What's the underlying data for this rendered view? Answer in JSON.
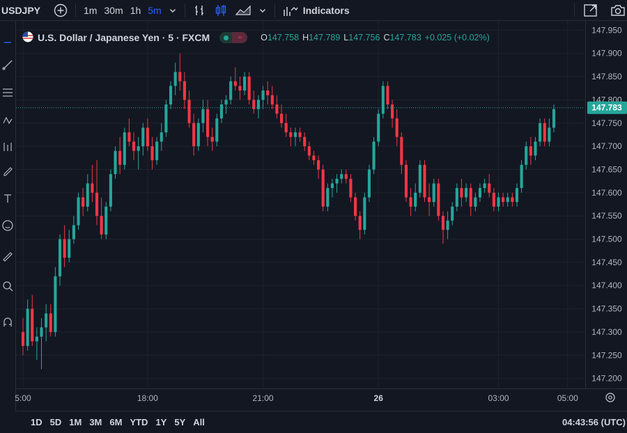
{
  "topbar": {
    "symbol": "USDJPY",
    "intervals": [
      "1m",
      "30m",
      "1h",
      "5m"
    ],
    "active_interval": "5m",
    "indicators_label": "Indicators",
    "icons": [
      "plus-circle-icon",
      "chevron-down-icon",
      "bar-style-icon",
      "candles-icon",
      "area-chart-icon",
      "indicators-icon",
      "snapshot-icon",
      "camera-icon"
    ]
  },
  "legend": {
    "title": "U.S. Dollar / Japanese Yen · 5 · FXCM",
    "open_label": "O",
    "open": "147.758",
    "high_label": "H",
    "high": "147.789",
    "low_label": "L",
    "low": "147.756",
    "close_label": "C",
    "close": "147.783",
    "change": "+0.025 (+0.02%)"
  },
  "price_axis": {
    "labels": [
      "147.950",
      "147.900",
      "147.850",
      "147.800",
      "147.750",
      "147.700",
      "147.650",
      "147.600",
      "147.550",
      "147.500",
      "147.450",
      "147.400",
      "147.350",
      "147.300",
      "147.250",
      "147.200"
    ],
    "last_price": "147.783"
  },
  "time_axis": {
    "labels": [
      "5:00",
      "18:00",
      "21:00",
      "26",
      "03:00",
      "05:00"
    ]
  },
  "bottombar": {
    "ranges": [
      "1D",
      "5D",
      "1M",
      "3M",
      "6M",
      "YTD",
      "1Y",
      "5Y",
      "All"
    ],
    "clock": "04:43:56 (UTC)"
  },
  "colors": {
    "background": "#131722",
    "up": "#26a69a",
    "down": "#f23645",
    "grid": "#1e222d",
    "accent": "#2962ff"
  },
  "chart_data": {
    "type": "candlestick",
    "symbol": "USDJPY",
    "interval": "5",
    "ylim": [
      147.18,
      147.97
    ],
    "last_price": 147.783,
    "x_ticks": [
      "5:00",
      "18:00",
      "21:00",
      "26",
      "03:00",
      "05:00"
    ],
    "candles": [
      [
        147.3,
        147.33,
        147.25,
        147.27
      ],
      [
        147.27,
        147.37,
        147.26,
        147.35
      ],
      [
        147.35,
        147.38,
        147.27,
        147.28
      ],
      [
        147.28,
        147.31,
        147.24,
        147.29
      ],
      [
        147.29,
        147.33,
        147.22,
        147.31
      ],
      [
        147.31,
        147.36,
        147.28,
        147.34
      ],
      [
        147.34,
        147.36,
        147.29,
        147.3
      ],
      [
        147.3,
        147.44,
        147.29,
        147.42
      ],
      [
        147.42,
        147.51,
        147.4,
        147.5
      ],
      [
        147.5,
        147.53,
        147.44,
        147.46
      ],
      [
        147.46,
        147.52,
        147.45,
        147.5
      ],
      [
        147.5,
        147.55,
        147.49,
        147.53
      ],
      [
        147.53,
        147.6,
        147.52,
        147.59
      ],
      [
        147.59,
        147.61,
        147.55,
        147.57
      ],
      [
        147.57,
        147.64,
        147.56,
        147.62
      ],
      [
        147.62,
        147.66,
        147.58,
        147.6
      ],
      [
        147.6,
        147.67,
        147.53,
        147.55
      ],
      [
        147.55,
        147.59,
        147.5,
        147.51
      ],
      [
        147.51,
        147.58,
        147.5,
        147.57
      ],
      [
        147.57,
        147.65,
        147.56,
        147.64
      ],
      [
        147.64,
        147.7,
        147.63,
        147.69
      ],
      [
        147.69,
        147.72,
        147.64,
        147.66
      ],
      [
        147.66,
        147.74,
        147.65,
        147.73
      ],
      [
        147.73,
        147.76,
        147.7,
        147.71
      ],
      [
        147.71,
        147.73,
        147.67,
        147.69
      ],
      [
        147.69,
        147.72,
        147.65,
        147.7
      ],
      [
        147.7,
        147.75,
        147.68,
        147.74
      ],
      [
        147.74,
        147.76,
        147.69,
        147.7
      ],
      [
        147.7,
        147.72,
        147.65,
        147.67
      ],
      [
        147.67,
        147.72,
        147.66,
        147.71
      ],
      [
        147.71,
        147.75,
        147.69,
        147.73
      ],
      [
        147.73,
        147.8,
        147.72,
        147.79
      ],
      [
        147.79,
        147.84,
        147.78,
        147.83
      ],
      [
        147.83,
        147.88,
        147.81,
        147.86
      ],
      [
        147.86,
        147.9,
        147.82,
        147.84
      ],
      [
        147.84,
        147.86,
        147.78,
        147.8
      ],
      [
        147.8,
        147.82,
        147.74,
        147.75
      ],
      [
        147.75,
        147.77,
        147.68,
        147.7
      ],
      [
        147.7,
        147.76,
        147.69,
        147.75
      ],
      [
        147.75,
        147.8,
        147.73,
        147.78
      ],
      [
        147.78,
        147.8,
        147.7,
        147.72
      ],
      [
        147.72,
        147.74,
        147.69,
        147.71
      ],
      [
        147.71,
        147.77,
        147.7,
        147.76
      ],
      [
        147.76,
        147.8,
        147.75,
        147.79
      ],
      [
        147.79,
        147.81,
        147.77,
        147.8
      ],
      [
        147.8,
        147.85,
        147.79,
        147.84
      ],
      [
        147.84,
        147.87,
        147.82,
        147.83
      ],
      [
        147.83,
        147.85,
        147.8,
        147.82
      ],
      [
        147.82,
        147.86,
        147.81,
        147.85
      ],
      [
        147.85,
        147.86,
        147.79,
        147.8
      ],
      [
        147.8,
        147.82,
        147.77,
        147.78
      ],
      [
        147.78,
        147.81,
        147.76,
        147.8
      ],
      [
        147.8,
        147.83,
        147.78,
        147.82
      ],
      [
        147.82,
        147.84,
        147.79,
        147.81
      ],
      [
        147.81,
        147.83,
        147.78,
        147.79
      ],
      [
        147.79,
        147.81,
        147.76,
        147.77
      ],
      [
        147.77,
        147.79,
        147.74,
        147.75
      ],
      [
        147.75,
        147.77,
        147.72,
        147.73
      ],
      [
        147.73,
        147.74,
        147.7,
        147.72
      ],
      [
        147.72,
        147.74,
        147.7,
        147.73
      ],
      [
        147.73,
        147.74,
        147.71,
        147.72
      ],
      [
        147.72,
        147.73,
        147.69,
        147.7
      ],
      [
        147.7,
        147.71,
        147.67,
        147.68
      ],
      [
        147.68,
        147.69,
        147.66,
        147.67
      ],
      [
        147.67,
        147.68,
        147.63,
        147.65
      ],
      [
        147.65,
        147.66,
        147.56,
        147.57
      ],
      [
        147.57,
        147.62,
        147.56,
        147.61
      ],
      [
        147.61,
        147.63,
        147.59,
        147.62
      ],
      [
        147.62,
        147.64,
        147.6,
        147.63
      ],
      [
        147.63,
        147.65,
        147.62,
        147.64
      ],
      [
        147.64,
        147.65,
        147.62,
        147.63
      ],
      [
        147.63,
        147.64,
        147.58,
        147.59
      ],
      [
        147.59,
        147.6,
        147.54,
        147.55
      ],
      [
        147.55,
        147.56,
        147.5,
        147.52
      ],
      [
        147.52,
        147.6,
        147.51,
        147.59
      ],
      [
        147.59,
        147.66,
        147.58,
        147.65
      ],
      [
        147.65,
        147.72,
        147.64,
        147.71
      ],
      [
        147.71,
        147.78,
        147.7,
        147.77
      ],
      [
        147.77,
        147.84,
        147.76,
        147.83
      ],
      [
        147.83,
        147.84,
        147.78,
        147.79
      ],
      [
        147.79,
        147.8,
        147.74,
        147.76
      ],
      [
        147.76,
        147.78,
        147.7,
        147.72
      ],
      [
        147.72,
        147.73,
        147.64,
        147.66
      ],
      [
        147.66,
        147.67,
        147.58,
        147.59
      ],
      [
        147.59,
        147.61,
        147.55,
        147.57
      ],
      [
        147.57,
        147.62,
        147.56,
        147.6
      ],
      [
        147.6,
        147.67,
        147.59,
        147.66
      ],
      [
        147.66,
        147.67,
        147.58,
        147.59
      ],
      [
        147.59,
        147.62,
        147.55,
        147.58
      ],
      [
        147.58,
        147.63,
        147.57,
        147.62
      ],
      [
        147.62,
        147.63,
        147.54,
        147.55
      ],
      [
        147.55,
        147.56,
        147.49,
        147.52
      ],
      [
        147.52,
        147.56,
        147.5,
        147.54
      ],
      [
        147.54,
        147.58,
        147.53,
        147.57
      ],
      [
        147.57,
        147.62,
        147.56,
        147.61
      ],
      [
        147.61,
        147.63,
        147.57,
        147.59
      ],
      [
        147.59,
        147.62,
        147.58,
        147.61
      ],
      [
        147.61,
        147.62,
        147.55,
        147.57
      ],
      [
        147.57,
        147.6,
        147.56,
        147.59
      ],
      [
        147.59,
        147.62,
        147.58,
        147.61
      ],
      [
        147.61,
        147.63,
        147.6,
        147.62
      ],
      [
        147.62,
        147.64,
        147.59,
        147.6
      ],
      [
        147.6,
        147.61,
        147.56,
        147.57
      ],
      [
        147.57,
        147.6,
        147.56,
        147.59
      ],
      [
        147.59,
        147.6,
        147.57,
        147.58
      ],
      [
        147.58,
        147.6,
        147.57,
        147.59
      ],
      [
        147.59,
        147.6,
        147.57,
        147.58
      ],
      [
        147.58,
        147.62,
        147.57,
        147.61
      ],
      [
        147.61,
        147.67,
        147.6,
        147.66
      ],
      [
        147.66,
        147.71,
        147.65,
        147.7
      ],
      [
        147.7,
        147.72,
        147.66,
        147.68
      ],
      [
        147.68,
        147.72,
        147.67,
        147.71
      ],
      [
        147.71,
        147.76,
        147.7,
        147.75
      ],
      [
        147.75,
        147.76,
        147.7,
        147.71
      ],
      [
        147.71,
        147.76,
        147.7,
        147.74
      ],
      [
        147.74,
        147.79,
        147.73,
        147.78
      ]
    ]
  }
}
